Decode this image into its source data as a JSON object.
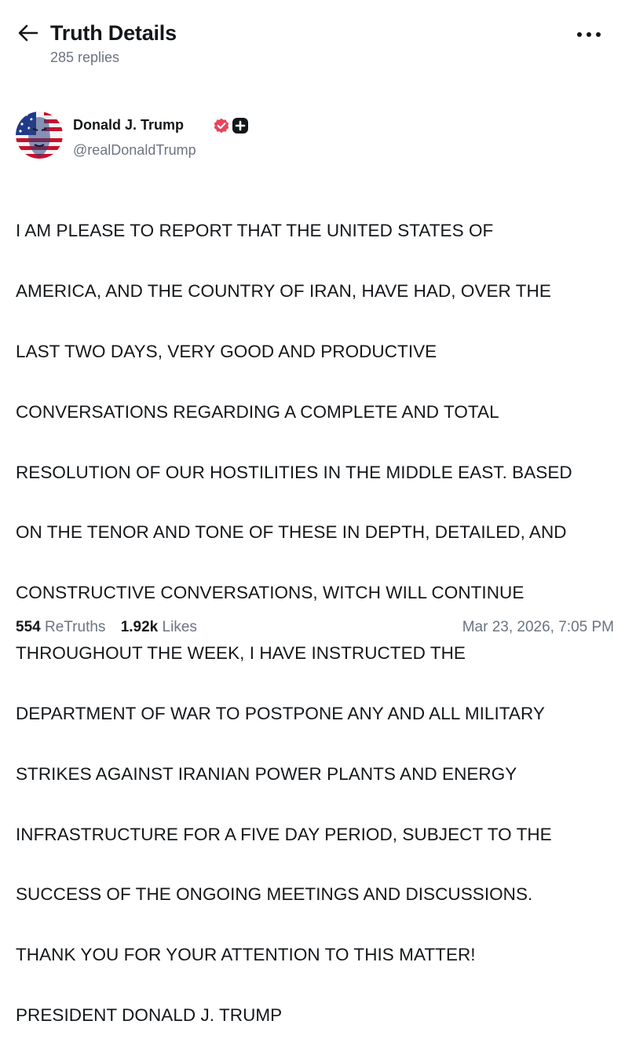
{
  "header": {
    "title": "Truth Details",
    "reply_count": "285 replies"
  },
  "icons": {
    "back": "arrow-left-icon",
    "more": "more-horizontal-icon",
    "verified": "verified-badge-icon",
    "plus": "plus-badge-icon"
  },
  "author": {
    "name": "Donald J. Trump",
    "handle": "@realDonaldTrump"
  },
  "post": {
    "lines": [
      "I AM PLEASE TO REPORT THAT THE UNITED STATES OF",
      "AMERICA, AND THE COUNTRY OF IRAN, HAVE HAD, OVER THE",
      "LAST TWO DAYS, VERY GOOD AND PRODUCTIVE",
      "CONVERSATIONS REGARDING A COMPLETE AND TOTAL",
      "RESOLUTION OF OUR HOSTILITIES IN THE MIDDLE EAST. BASED",
      "ON THE TENOR AND TONE OF THESE IN DEPTH, DETAILED, AND",
      "CONSTRUCTIVE CONVERSATIONS, WITCH WILL CONTINUE",
      "THROUGHOUT THE WEEK, I HAVE INSTRUCTED THE",
      "DEPARTMENT OF WAR TO POSTPONE ANY AND ALL MILITARY",
      "STRIKES AGAINST IRANIAN POWER PLANTS AND ENERGY",
      "INFRASTRUCTURE FOR A FIVE DAY PERIOD, SUBJECT TO THE",
      "SUCCESS OF THE ONGOING MEETINGS AND DISCUSSIONS.",
      "THANK YOU FOR YOUR ATTENTION TO THIS MATTER!",
      "PRESIDENT DONALD J. TRUMP"
    ]
  },
  "stats": {
    "retruths_count": "554",
    "retruths_label": "ReTruths",
    "likes_count": "1.92k",
    "likes_label": "Likes",
    "timestamp": "Mar 23, 2026, 7:05 PM"
  },
  "colors": {
    "text": "#14171a",
    "muted": "#6b7480",
    "verified": "#e8455b",
    "background": "#ffffff"
  }
}
